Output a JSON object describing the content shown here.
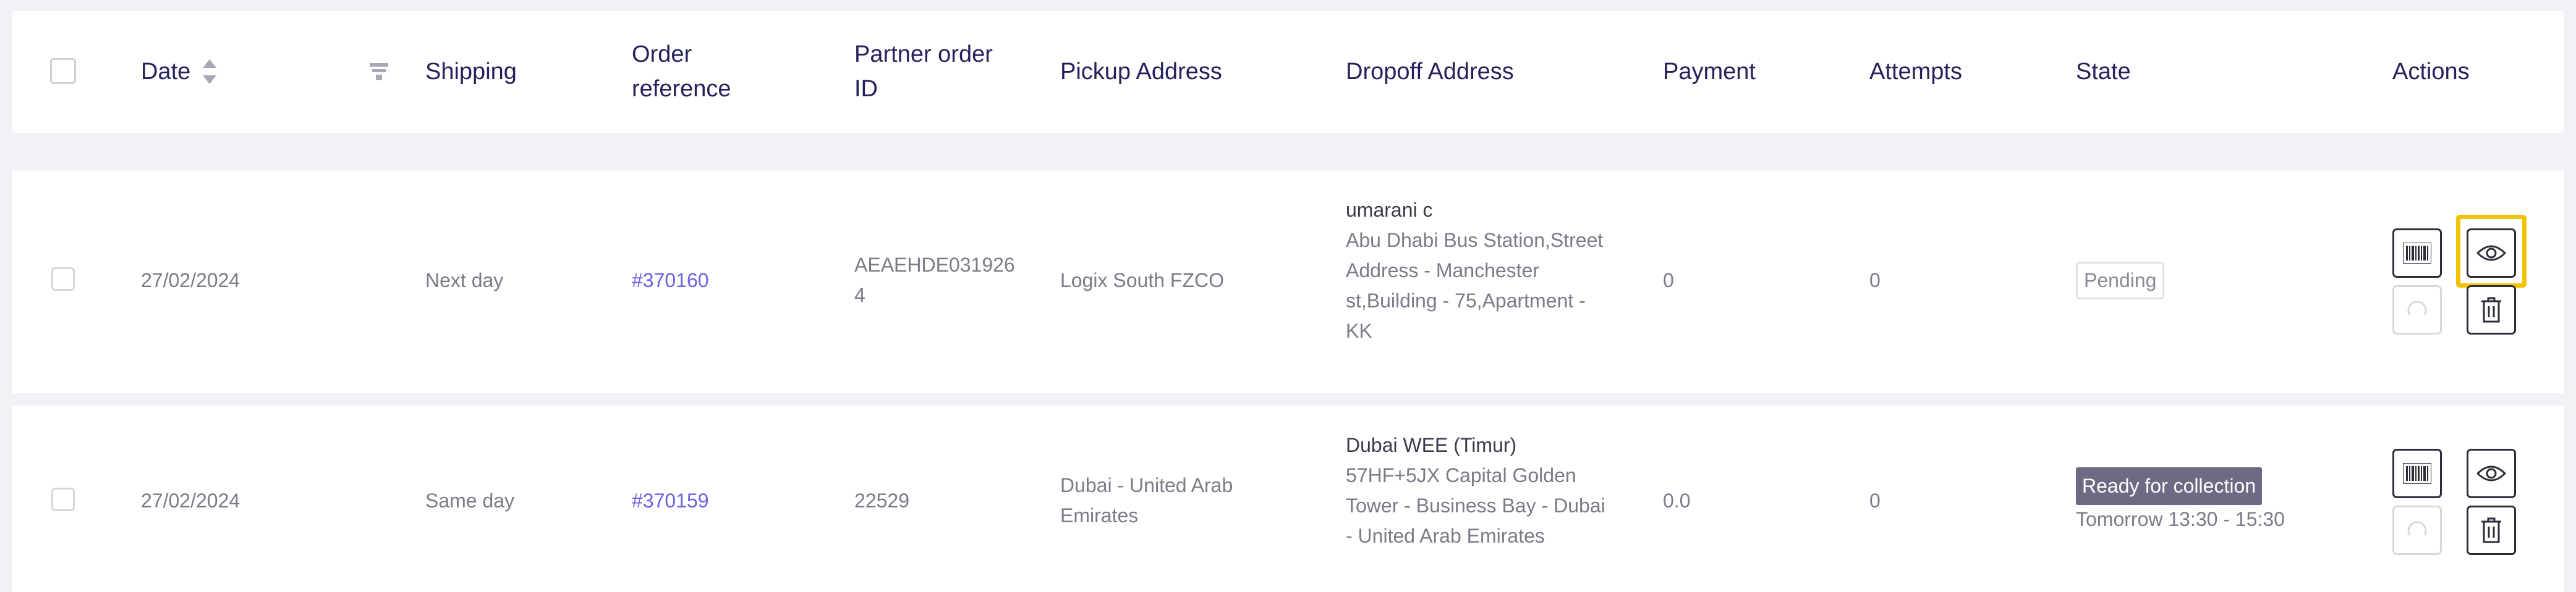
{
  "header": {
    "date": "Date",
    "shipping": "Shipping",
    "order_reference": [
      "Order",
      "reference"
    ],
    "partner_order_id": [
      "Partner order",
      "ID"
    ],
    "pickup_address": "Pickup Address",
    "dropoff_address": "Dropoff Address",
    "payment": "Payment",
    "attempts": "Attempts",
    "state": "State",
    "actions": "Actions"
  },
  "rows": [
    {
      "date": "27/02/2024",
      "shipping": "Next day",
      "order_reference": "#370160",
      "partner_order_id": [
        "AEAEHDE031926",
        "4"
      ],
      "pickup_address": [
        "Logix South FZCO"
      ],
      "dropoff": {
        "name": "umarani c",
        "address_lines": [
          "Abu Dhabi Bus Station,Street",
          "Address - Manchester",
          "st,Building - 75,Apartment -",
          "KK"
        ]
      },
      "payment": "0",
      "attempts": "0",
      "state": "Pending",
      "state_subtext": ""
    },
    {
      "date": "27/02/2024",
      "shipping": "Same day",
      "order_reference": "#370159",
      "partner_order_id": [
        "22529"
      ],
      "pickup_address": [
        "Dubai - United Arab",
        "Emirates"
      ],
      "dropoff": {
        "name": "Dubai WEE (Timur)",
        "address_lines": [
          "57HF+5JX Capital Golden",
          "Tower - Business Bay - Dubai",
          "- United Arab Emirates"
        ]
      },
      "payment": "0.0",
      "attempts": "0",
      "state": "Ready for collection",
      "state_subtext": "Tomorrow 13:30 - 15:30"
    }
  ],
  "icons": {
    "barcode": "barcode-icon",
    "view": "eye-icon",
    "retry": "refresh-icon",
    "delete": "trash-icon",
    "sort": "sort-icon",
    "filter": "filter-icon"
  },
  "colors": {
    "link": "#6b63e0",
    "heading": "#25215c",
    "ready_badge": "#6e6a83",
    "highlight": "#f2c300"
  }
}
